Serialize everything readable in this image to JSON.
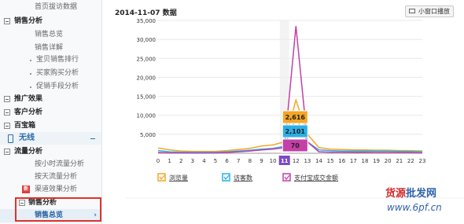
{
  "sidebar": {
    "top_item": "首页拔访数据",
    "sales_section": "销售分析",
    "sales_overview": "销售总览",
    "sales_detail": "销售详解",
    "sub_items": [
      "宝贝销售排行",
      "买家购买分析",
      "促销手段分析"
    ],
    "promo": "推广效果",
    "customer": "客户分析",
    "baibao": "百宝箱",
    "wireless": "无线",
    "traffic": "流量分析",
    "hourly": "按小时流量分析",
    "by_day": "按天流量分析",
    "channel": "渠道效果分析",
    "new_badge": "新",
    "wireless_sales": "销售分析",
    "wireless_overview": "销售总览",
    "arrow": "›"
  },
  "header": {
    "title": "2014-11-07 数据",
    "popout_button": "小窗口播放"
  },
  "chart_data": {
    "type": "line",
    "title": "2014-11-07 数据",
    "x": [
      0,
      1,
      2,
      3,
      4,
      5,
      6,
      7,
      8,
      9,
      10,
      11,
      12,
      13,
      14,
      15,
      16,
      17,
      18,
      19,
      20,
      21,
      22,
      23
    ],
    "ylim": [
      0,
      35000
    ],
    "yticks": [
      5000,
      10000,
      15000,
      20000,
      25000,
      30000,
      35000
    ],
    "ytick_labels": [
      "5,000",
      "10,000",
      "15,000",
      "20,000",
      "25,000",
      "30,000",
      "35,000"
    ],
    "grid": true,
    "legend_position": "bottom",
    "highlight_x": 11,
    "series": [
      {
        "name": "浏览量",
        "color": "#f5a623",
        "values": [
          1400,
          900,
          600,
          500,
          500,
          500,
          700,
          1000,
          1300,
          1900,
          2200,
          3000,
          14000,
          5000,
          1500,
          1100,
          1000,
          900,
          900,
          800,
          800,
          700,
          700,
          600
        ]
      },
      {
        "name": "访客数",
        "color": "#2ab0e6",
        "values": [
          700,
          400,
          300,
          250,
          250,
          250,
          400,
          600,
          800,
          1100,
          1300,
          1800,
          9500,
          3000,
          900,
          700,
          600,
          600,
          600,
          550,
          550,
          500,
          450,
          400
        ]
      },
      {
        "name": "支付宝成交金额",
        "color": "#c43fa8",
        "values": [
          200,
          100,
          80,
          60,
          60,
          80,
          200,
          400,
          600,
          900,
          1100,
          1500,
          33500,
          3000,
          400,
          300,
          300,
          250,
          250,
          200,
          200,
          200,
          150,
          100
        ]
      }
    ],
    "tooltips": [
      {
        "label": "2,616",
        "color": "#f5a623"
      },
      {
        "label": "2,101",
        "color": "#2ab0e6"
      },
      {
        "label": "70",
        "color": "#c43fa8"
      }
    ]
  },
  "watermark": {
    "line1_a": "货源",
    "line1_b": "批发网",
    "line2": "www.6pf.cn"
  }
}
